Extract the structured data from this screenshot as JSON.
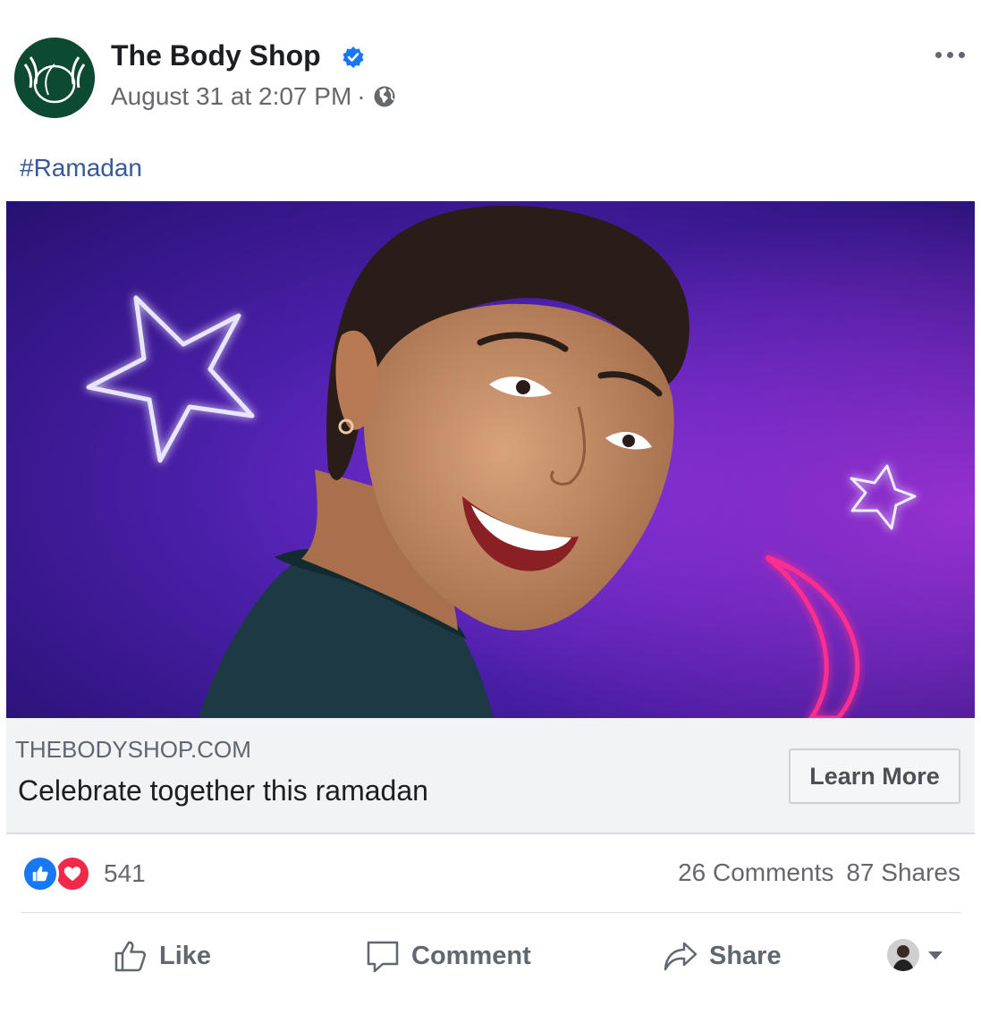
{
  "post": {
    "page_name": "The Body Shop",
    "verified_icon": "verified-badge-icon",
    "timestamp": "August 31 at 2:07 PM",
    "separator": "·",
    "privacy_icon": "globe-icon",
    "more_icon": "more-options-icon",
    "hashtag": "#Ramadan"
  },
  "link_preview": {
    "domain": "THEBODYSHOP.COM",
    "title": "Celebrate together this ramadan",
    "cta_label": "Learn More"
  },
  "engagement": {
    "reaction_icons": [
      "like-reaction-icon",
      "love-reaction-icon"
    ],
    "reaction_count": "541",
    "comments": "26 Comments",
    "shares": "87 Shares"
  },
  "actions": {
    "like_label": "Like",
    "comment_label": "Comment",
    "share_label": "Share"
  },
  "colors": {
    "link_blue": "#385898",
    "facebook_blue": "#1877f2",
    "love_red": "#f02849",
    "brand_green": "#0d4a32",
    "hero_purple": "#4a1fa8",
    "neon_pink": "#ff2d8f"
  }
}
